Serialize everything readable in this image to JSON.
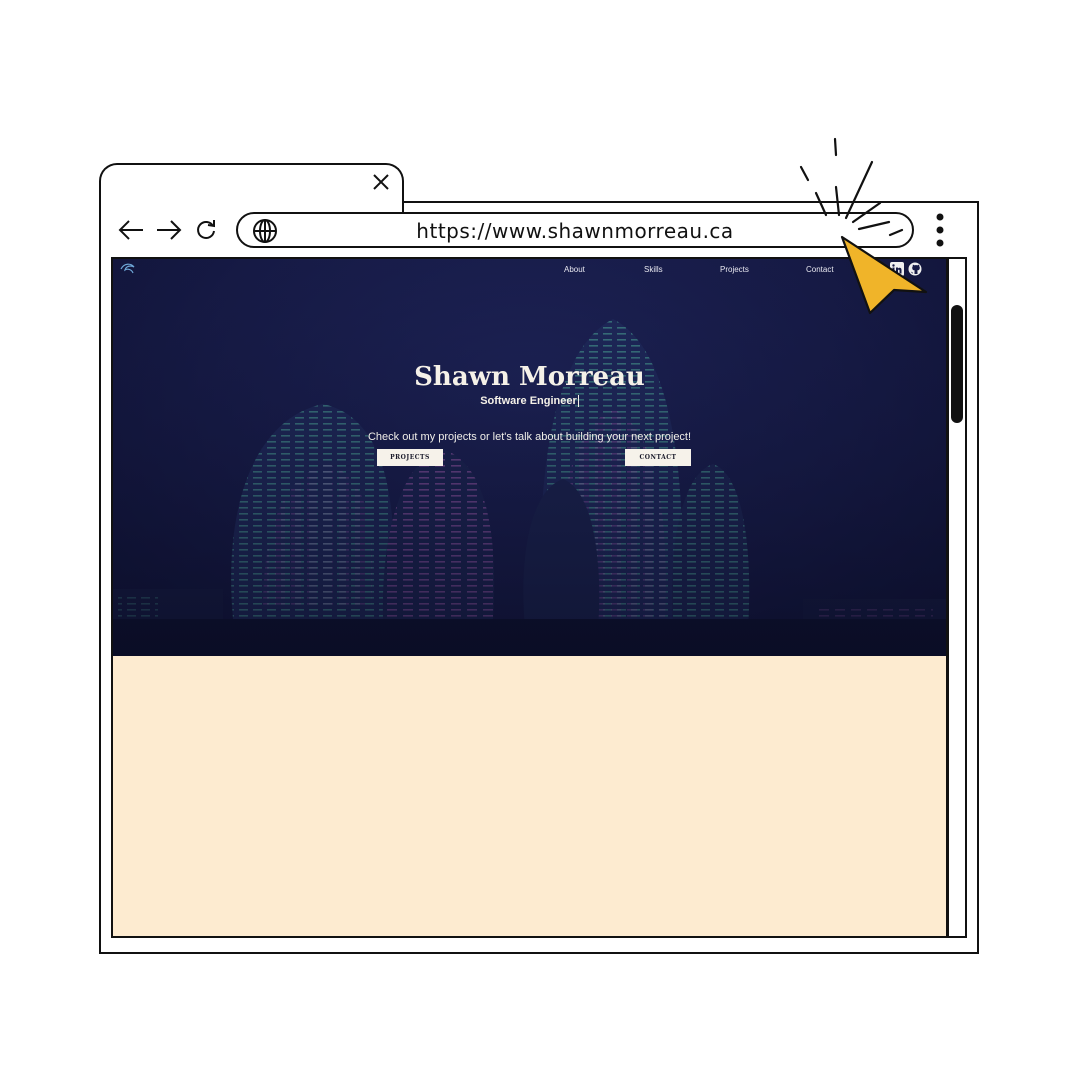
{
  "browser": {
    "url": "https://www.shawnmorreau.ca",
    "icons": [
      "close-icon",
      "back-arrow-icon",
      "forward-arrow-icon",
      "reload-icon",
      "globe-icon",
      "kebab-menu-icon"
    ]
  },
  "site": {
    "nav": {
      "about": "About",
      "skills": "Skills",
      "projects": "Projects",
      "contact": "Contact"
    },
    "social_icons": [
      "linkedin-icon",
      "github-icon"
    ],
    "hero": {
      "name": "Shawn Morreau",
      "role": "Software Engineer",
      "tagline": "Check out my projects or let's talk about building your next project!",
      "projects_button": "PROJECTS",
      "contact_button": "CONTACT"
    }
  },
  "colors": {
    "hero_background": "#161a45",
    "lower_section": "#fdebd0",
    "cursor": "#f0b429"
  }
}
